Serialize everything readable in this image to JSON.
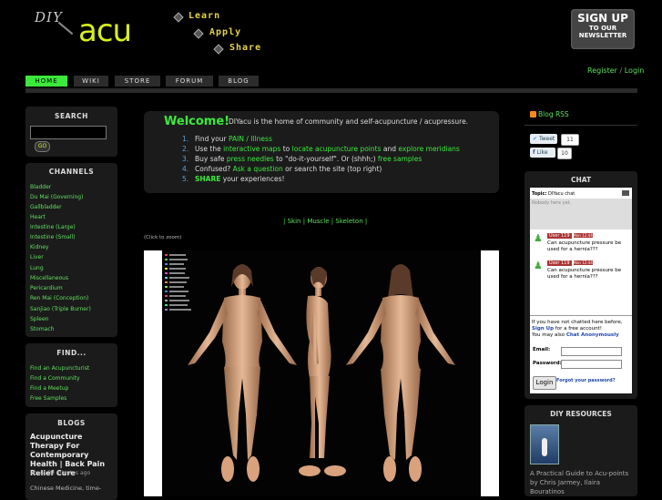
{
  "header": {
    "logo_diy": "DIY",
    "logo_acu": "acu",
    "taglines": [
      "Learn",
      "Apply",
      "Share"
    ],
    "newsletter": {
      "line1": "SIGN UP",
      "line2": "TO OUR",
      "line3": "NEWSLETTER"
    },
    "register": "Register",
    "sep": "/",
    "login": "Login"
  },
  "nav": [
    "HOME",
    "WIKI",
    "STORE",
    "FORUM",
    "BLOG"
  ],
  "search": {
    "title": "SEARCH",
    "go": "GO"
  },
  "channels": {
    "title": "CHANNELS",
    "items": [
      "Bladder",
      "Du Mai (Governing)",
      "Gallbladder",
      "Heart",
      "Intestine (Large)",
      "Intestine (Small)",
      "Kidney",
      "Liver",
      "Lung",
      "Miscellaneous",
      "Pericardium",
      "Ren Mai (Conception)",
      "Sanjiao (Triple Burner)",
      "Spleen",
      "Stomach"
    ]
  },
  "find": {
    "title": "FIND...",
    "items": [
      "Find an Acupuncturist",
      "Find a Community",
      "Find a Meetup",
      "Free Samples"
    ]
  },
  "blogs": {
    "title": "BLOGS",
    "post_title": "Acupuncture Therapy For Contemporary Health | Back Pain Relief Cure",
    "post_time": "about 39 minutes ago",
    "post_excerpt": "Chinese Medicine, time-"
  },
  "welcome": {
    "title": "Welcome!",
    "intro": "DIYacu is the home of community and self-acupuncture / acupressure.",
    "items": [
      {
        "n": "1.",
        "parts": [
          "Find your ",
          "PAIN / Illness"
        ]
      },
      {
        "n": "2.",
        "parts": [
          "Use the ",
          "interactive maps",
          " to ",
          "locate acupuncture points",
          " and ",
          "explore meridians"
        ]
      },
      {
        "n": "3.",
        "parts": [
          "Buy safe ",
          "press needles",
          " to \"do-it-yourself\". Or (shhh;) ",
          "free samples"
        ]
      },
      {
        "n": "4.",
        "parts": [
          "Confused? ",
          "Ask a question",
          " or search the site (top right)"
        ]
      },
      {
        "n": "5.",
        "parts": [
          "SHARE",
          " your experiences!"
        ]
      }
    ]
  },
  "views": {
    "sep": "|",
    "skin": "Skin",
    "muscle": "Muscle",
    "skeleton": "Skeleton"
  },
  "zoom_hint": "(Click to zoom)",
  "right": {
    "blog_rss": "Blog RSS",
    "tweet": "Tweet",
    "tweet_count": "11",
    "like": "Like",
    "like_count": "10",
    "chat": {
      "title": "CHAT",
      "topic_label": "Topic:",
      "topic": "DIYacu chat",
      "nobody": "Nobody here yet.",
      "messages": [
        {
          "user": "User 119",
          "time": "Mon 12:44",
          "text": "Can acupuncture pressure be used for a hernia???"
        },
        {
          "user": "User 119",
          "time": "Mon 12:44",
          "text": "Can acupuncture pressure be used for a hernia???"
        }
      ],
      "note1": "If you have not chatted here before,",
      "signup": "Sign Up",
      "note2": " for a free account!",
      "note3": "You may also ",
      "anon": "Chat Anonymously",
      "email_label": "Email:",
      "password_label": "Password:",
      "login_btn": "Login",
      "forgot": "Forgot your password?"
    },
    "resources": {
      "title": "DIY RESOURCES",
      "book_title": "A Practical Guide to Acu-points by Chris Jarmey, Ilaira Bouratinos"
    }
  },
  "colors": {
    "accent": "#3ce83c",
    "logo": "#d8ef1c",
    "link": "#5fe05f",
    "box": "#1b1b1b"
  }
}
